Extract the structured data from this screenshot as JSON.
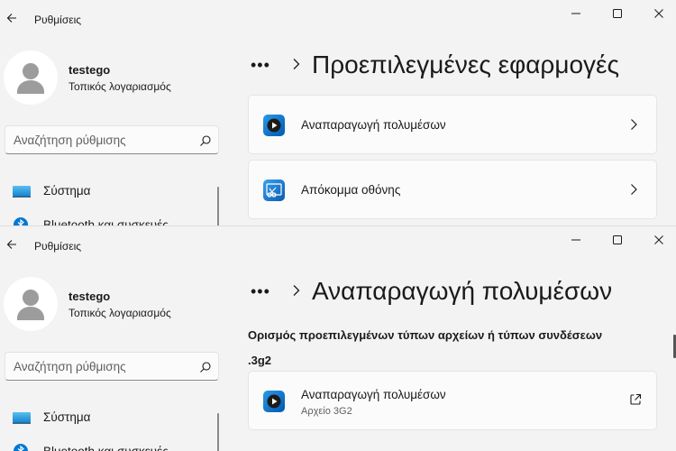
{
  "app": {
    "title": "Ρυθμίσεις"
  },
  "user": {
    "name": "testego",
    "account_type": "Τοπικός λογαριασμός"
  },
  "search": {
    "placeholder": "Αναζήτηση ρύθμισης"
  },
  "sidebar": {
    "items": [
      {
        "label": "Σύστημα",
        "icon": "system-monitor-icon"
      },
      {
        "label": "Bluetooth και συσκευές",
        "icon": "bluetooth-icon"
      }
    ]
  },
  "top_window": {
    "breadcrumb_more": "•••",
    "title": "Προεπιλεγμένες εφαρμογές",
    "apps": [
      {
        "label": "Αναπαραγωγή πολυμέσων",
        "icon": "media-player-icon"
      },
      {
        "label": "Απόκομμα οθόνης",
        "icon": "snipping-tool-icon"
      }
    ]
  },
  "bottom_window": {
    "breadcrumb_more": "•••",
    "title": "Αναπαραγωγή πολυμέσων",
    "section_heading": "Ορισμός προεπιλεγμένων τύπων αρχείων ή τύπων συνδέσεων",
    "extension": ".3g2",
    "default_app": {
      "label": "Αναπαραγωγή πολυμέσων",
      "sublabel": "Αρχείο 3G2",
      "icon": "media-player-icon"
    }
  },
  "colors": {
    "accent": "#0067c0",
    "background": "#f3f3f3",
    "card": "#fbfbfb"
  }
}
